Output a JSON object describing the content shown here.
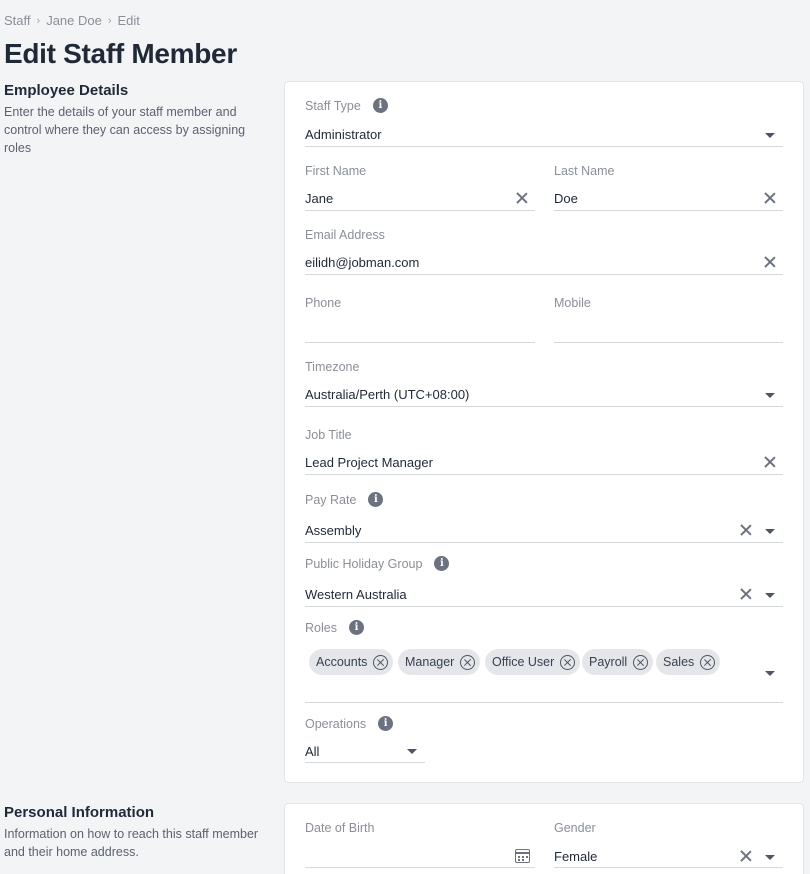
{
  "breadcrumb": [
    "Staff",
    "Jane Doe",
    "Edit"
  ],
  "page_title": "Edit Staff Member",
  "employee_section": {
    "title": "Employee Details",
    "description": "Enter the details of your staff member and control where they can access by assigning roles"
  },
  "personal_section": {
    "title": "Personal Information",
    "description": "Information on how to reach this staff member and their home address."
  },
  "form": {
    "staff_type": {
      "label": "Staff Type",
      "value": "Administrator"
    },
    "first_name": {
      "label": "First Name",
      "value": "Jane"
    },
    "last_name": {
      "label": "Last Name",
      "value": "Doe"
    },
    "email": {
      "label": "Email Address",
      "value": "eilidh@jobman.com"
    },
    "phone": {
      "label": "Phone",
      "value": ""
    },
    "mobile": {
      "label": "Mobile",
      "value": ""
    },
    "timezone": {
      "label": "Timezone",
      "value": "Australia/Perth (UTC+08:00)"
    },
    "job_title": {
      "label": "Job Title",
      "value": "Lead Project Manager"
    },
    "pay_rate": {
      "label": "Pay Rate",
      "value": "Assembly"
    },
    "holiday_group": {
      "label": "Public Holiday Group",
      "value": "Western Australia"
    },
    "roles": {
      "label": "Roles",
      "chips": [
        "Accounts",
        "Manager",
        "Office User",
        "Payroll",
        "Sales"
      ]
    },
    "operations": {
      "label": "Operations",
      "value": "All"
    },
    "dob": {
      "label": "Date of Birth",
      "value": ""
    },
    "gender": {
      "label": "Gender",
      "value": "Female"
    }
  },
  "icons": {
    "info": "info-icon",
    "clear": "close-icon",
    "dropdown": "chevron-down-icon",
    "calendar": "calendar-icon"
  },
  "colors": {
    "background": "#f3f4f6",
    "card": "#ffffff",
    "text": "#1f2937",
    "label": "#8a8f98",
    "chip": "#e4e6ea"
  }
}
